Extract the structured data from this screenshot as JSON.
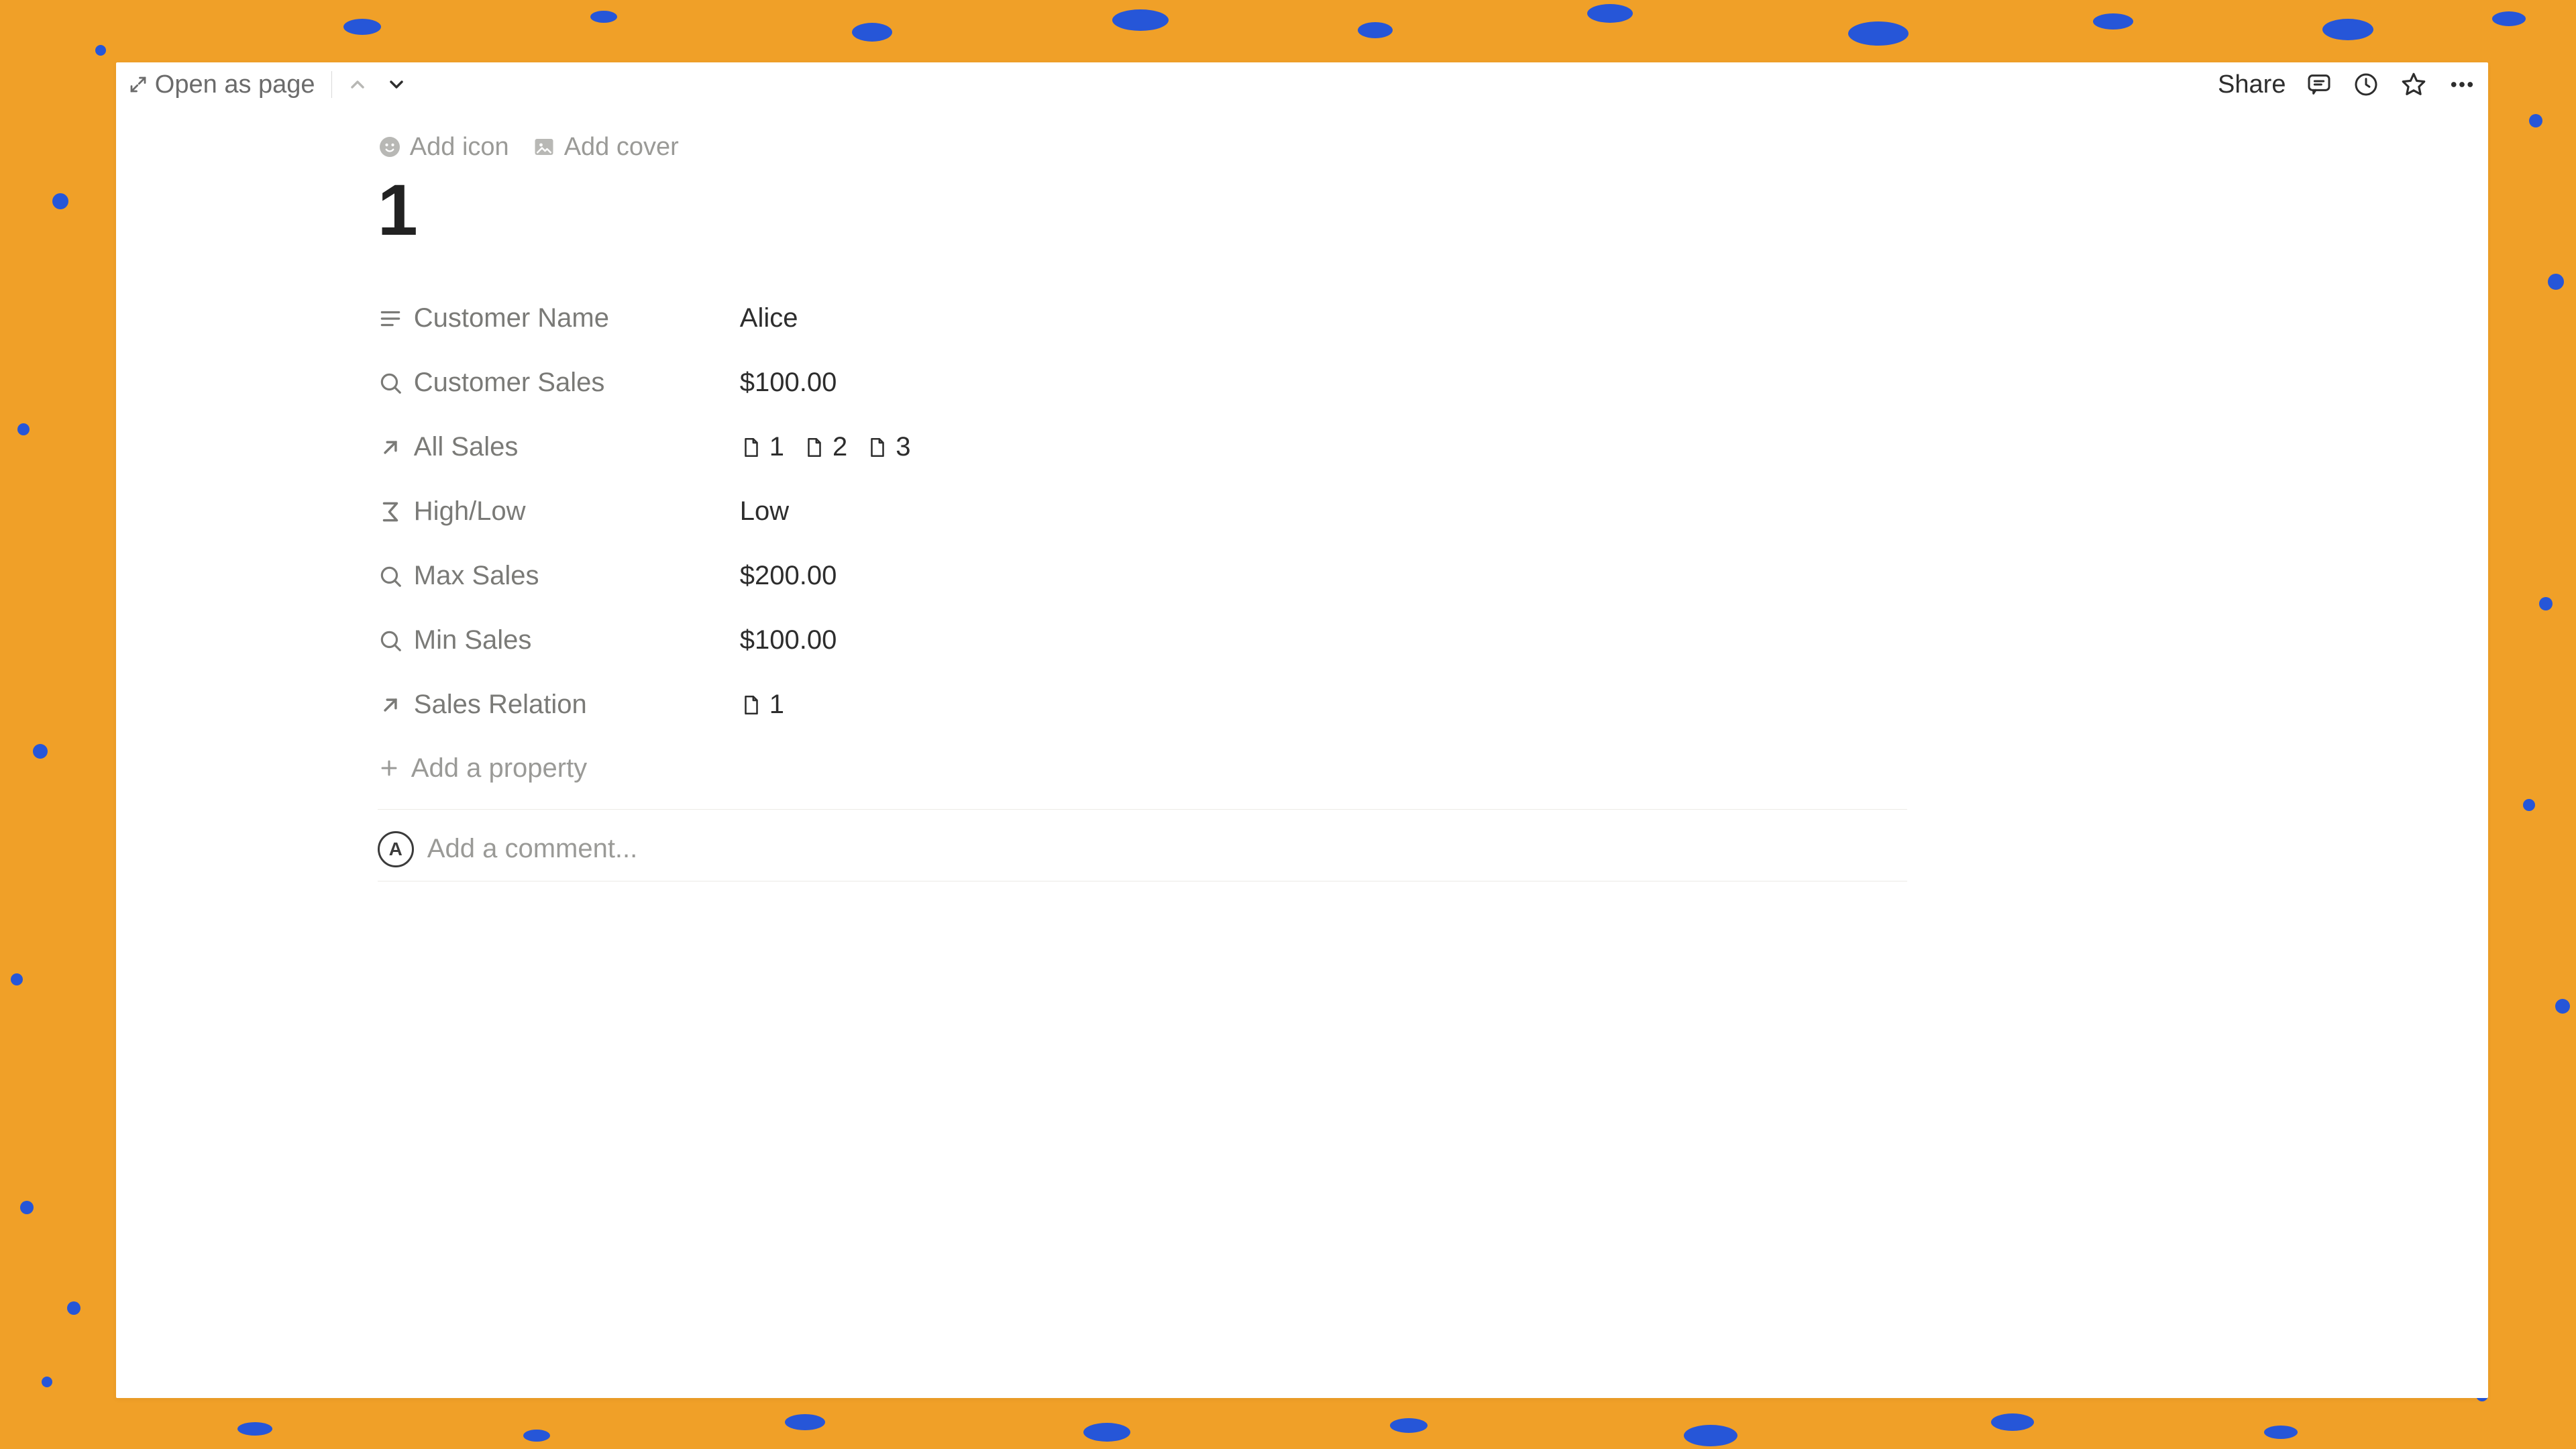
{
  "topbar": {
    "open_as_page": "Open as page",
    "share": "Share"
  },
  "meta": {
    "add_icon": "Add icon",
    "add_cover": "Add cover"
  },
  "page": {
    "title": "1"
  },
  "properties": {
    "customer_name": {
      "label": "Customer Name",
      "value": "Alice"
    },
    "customer_sales": {
      "label": "Customer Sales",
      "value": "$100.00"
    },
    "all_sales": {
      "label": "All Sales",
      "items": [
        "1",
        "2",
        "3"
      ]
    },
    "high_low": {
      "label": "High/Low",
      "value": "Low"
    },
    "max_sales": {
      "label": "Max Sales",
      "value": "$200.00"
    },
    "min_sales": {
      "label": "Min Sales",
      "value": "$100.00"
    },
    "sales_relation": {
      "label": "Sales Relation",
      "items": [
        "1"
      ]
    }
  },
  "add_property": "Add a property",
  "comment": {
    "avatar_initial": "A",
    "placeholder": "Add a comment..."
  }
}
